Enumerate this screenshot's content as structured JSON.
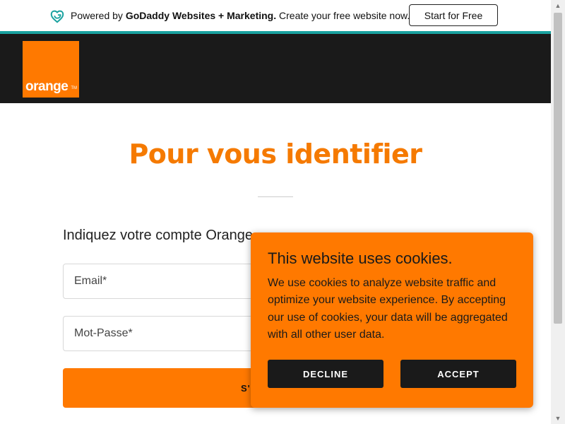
{
  "banner": {
    "prefix": "Powered by ",
    "brand": "GoDaddy Websites + Marketing.",
    "suffix": " Create your free website now.",
    "cta_label": "Start for Free",
    "accent_color": "#1aa2a0"
  },
  "header": {
    "logo_text": "orange",
    "logo_trademark": "TM",
    "brand_color": "#ff7900"
  },
  "main": {
    "title": "Pour vous identifier",
    "prompt": "Indiquez votre compte Orange",
    "email_placeholder": "Email*",
    "password_placeholder": "Mot-Passe*",
    "submit_label": "S'IDENTIFIER"
  },
  "cookie": {
    "title": "This website uses cookies.",
    "body": "We use cookies to analyze website traffic and optimize your website experience. By accepting our use of cookies, your data will be aggregated with all other user data.",
    "decline_label": "DECLINE",
    "accept_label": "ACCEPT"
  },
  "icons": {
    "banner_logo": "godaddy-heart-icon",
    "scroll_up": "chevron-up-icon",
    "scroll_down": "chevron-down-icon"
  }
}
